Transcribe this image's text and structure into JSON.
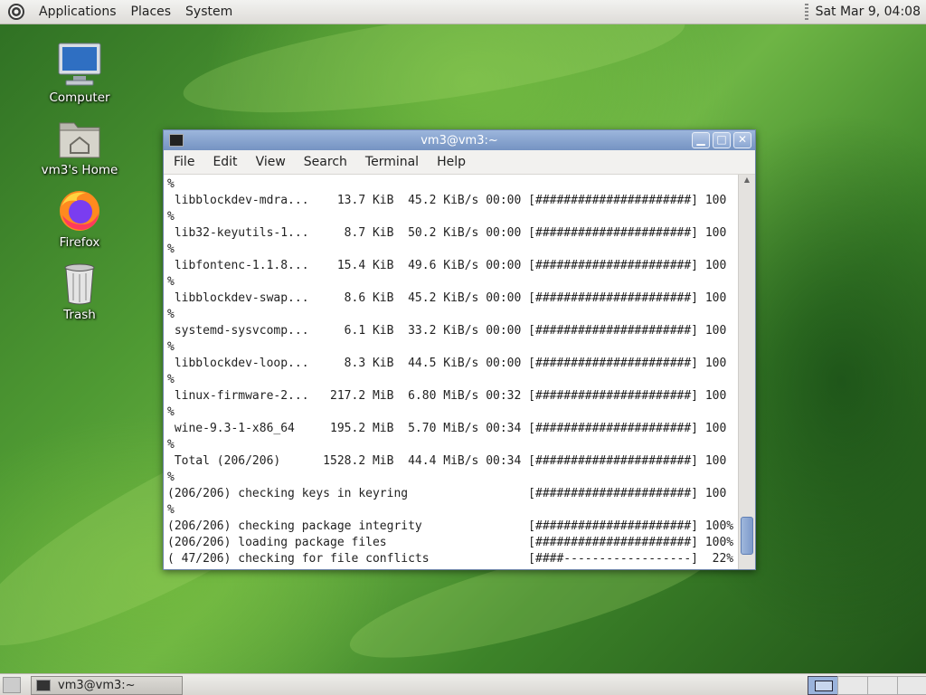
{
  "top_panel": {
    "menus": [
      "Applications",
      "Places",
      "System"
    ],
    "clock": "Sat Mar  9, 04:08"
  },
  "desktop": {
    "icons": [
      {
        "label": "Computer",
        "icon": "computer-icon"
      },
      {
        "label": "vm3's Home",
        "icon": "home-folder-icon"
      },
      {
        "label": "Firefox",
        "icon": "firefox-icon"
      },
      {
        "label": "Trash",
        "icon": "trash-icon"
      }
    ]
  },
  "window": {
    "title": "vm3@vm3:~",
    "menu": [
      "File",
      "Edit",
      "View",
      "Search",
      "Terminal",
      "Help"
    ],
    "terminal_lines": [
      "%",
      " libblockdev-mdra...    13.7 KiB  45.2 KiB/s 00:00 [######################] 100",
      "%",
      " lib32-keyutils-1...     8.7 KiB  50.2 KiB/s 00:00 [######################] 100",
      "%",
      " libfontenc-1.1.8...    15.4 KiB  49.6 KiB/s 00:00 [######################] 100",
      "%",
      " libblockdev-swap...     8.6 KiB  45.2 KiB/s 00:00 [######################] 100",
      "%",
      " systemd-sysvcomp...     6.1 KiB  33.2 KiB/s 00:00 [######################] 100",
      "%",
      " libblockdev-loop...     8.3 KiB  44.5 KiB/s 00:00 [######################] 100",
      "%",
      " linux-firmware-2...   217.2 MiB  6.80 MiB/s 00:32 [######################] 100",
      "%",
      " wine-9.3-1-x86_64     195.2 MiB  5.70 MiB/s 00:34 [######################] 100",
      "%",
      " Total (206/206)      1528.2 MiB  44.4 MiB/s 00:34 [######################] 100",
      "%",
      "(206/206) checking keys in keyring                 [######################] 100",
      "%",
      "(206/206) checking package integrity               [######################] 100%",
      "(206/206) loading package files                    [######################] 100%",
      "( 47/206) checking for file conflicts              [####------------------]  22%"
    ]
  },
  "taskbar": {
    "task_label": "vm3@vm3:~"
  }
}
